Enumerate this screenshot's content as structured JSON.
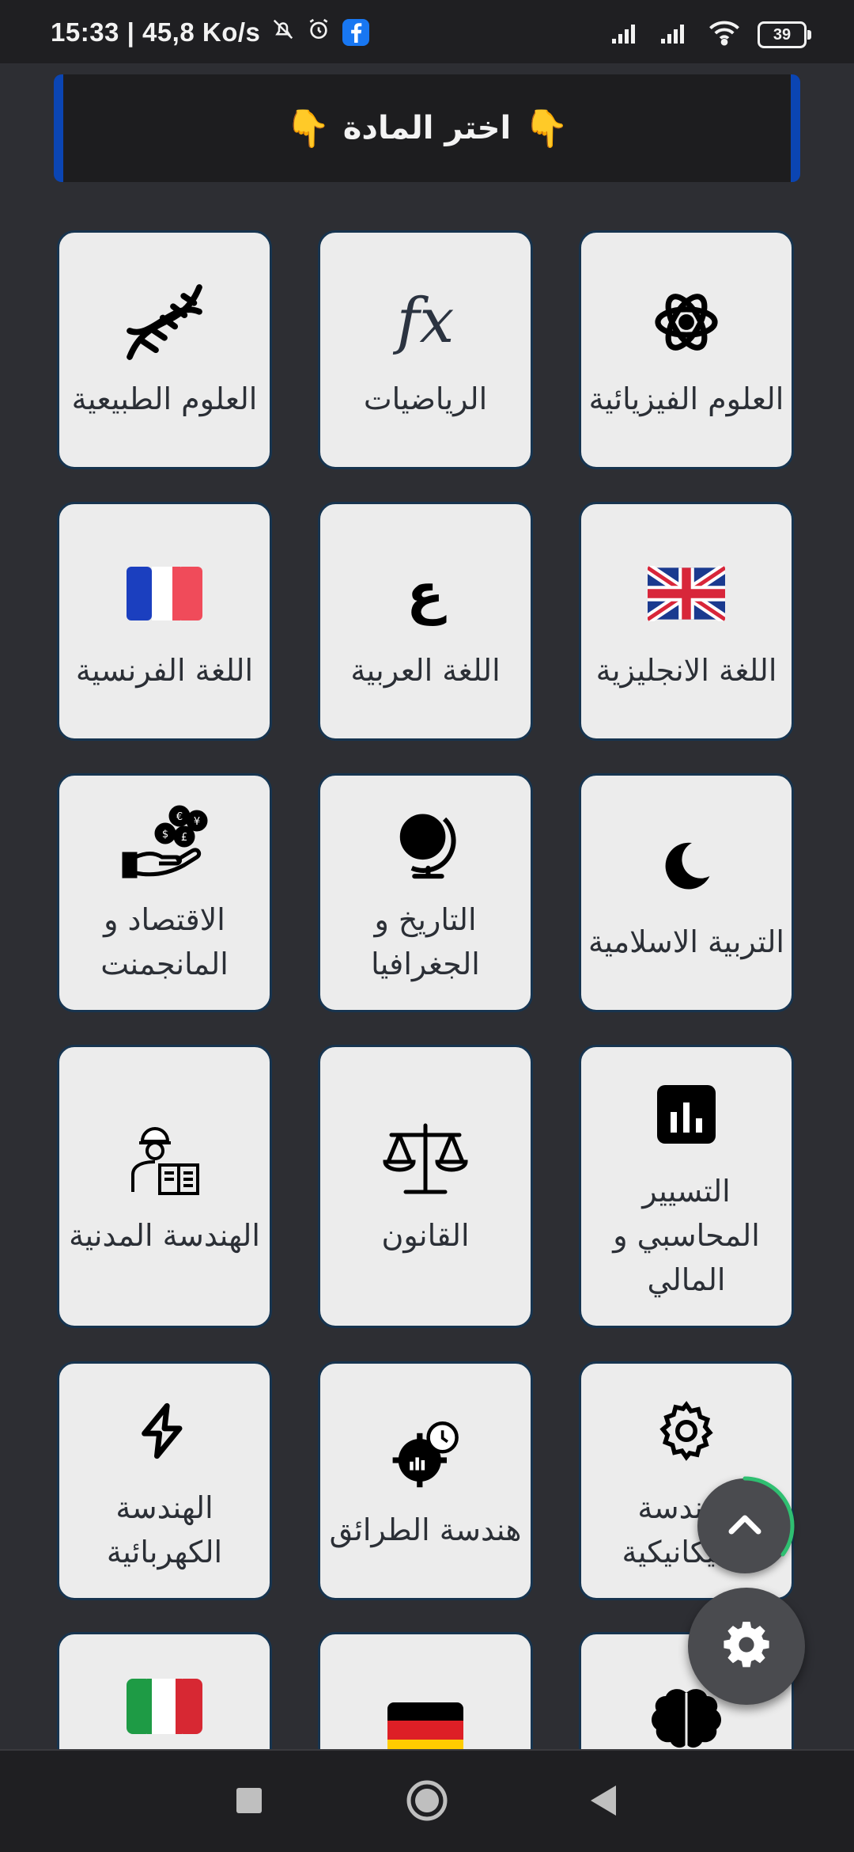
{
  "status_bar": {
    "time_speed": "15:33 | 45,8 Ko/s",
    "battery": "39"
  },
  "header": {
    "title": "اختر المادة",
    "hand_left": "👇",
    "hand_right": "👇"
  },
  "subjects": [
    {
      "label": "العلوم الفيزيائية",
      "icon": "atom-icon"
    },
    {
      "label": "الرياضيات",
      "icon": "fx-icon"
    },
    {
      "label": "العلوم الطبيعية",
      "icon": "dna-icon"
    },
    {
      "label": "اللغة الانجليزية",
      "icon": "uk-flag-icon"
    },
    {
      "label": "اللغة العربية",
      "icon": "arabic-letter-icon",
      "glyph": "ع"
    },
    {
      "label": "اللغة الفرنسية",
      "icon": "france-flag-icon"
    },
    {
      "label": "التربية الاسلامية",
      "icon": "crescent-icon"
    },
    {
      "label": "التاريخ و الجغرافيا",
      "icon": "globe-icon"
    },
    {
      "label": "الاقتصاد و المانجمنت",
      "icon": "money-hand-icon"
    },
    {
      "label": "التسيير المحاسبي و المالي",
      "icon": "bar-chart-icon"
    },
    {
      "label": "القانون",
      "icon": "scales-icon"
    },
    {
      "label": "الهندسة المدنية",
      "icon": "engineer-icon"
    },
    {
      "label": "الهندسة الميكانيكية",
      "icon": "gear-icon"
    },
    {
      "label": "هندسة الطرائق",
      "icon": "process-gear-icon"
    },
    {
      "label": "الهندسة الكهربائية",
      "icon": "lightning-icon"
    },
    {
      "label": "",
      "icon": "brain-icon"
    },
    {
      "label": "",
      "icon": "germany-flag-icon"
    },
    {
      "label": "",
      "icon": "italy-flag-icon"
    }
  ],
  "colors": {
    "background": "#2d2e33",
    "card": "#ececec",
    "banner_border": "#0b45b3",
    "accent_ring": "#2fbf71"
  }
}
